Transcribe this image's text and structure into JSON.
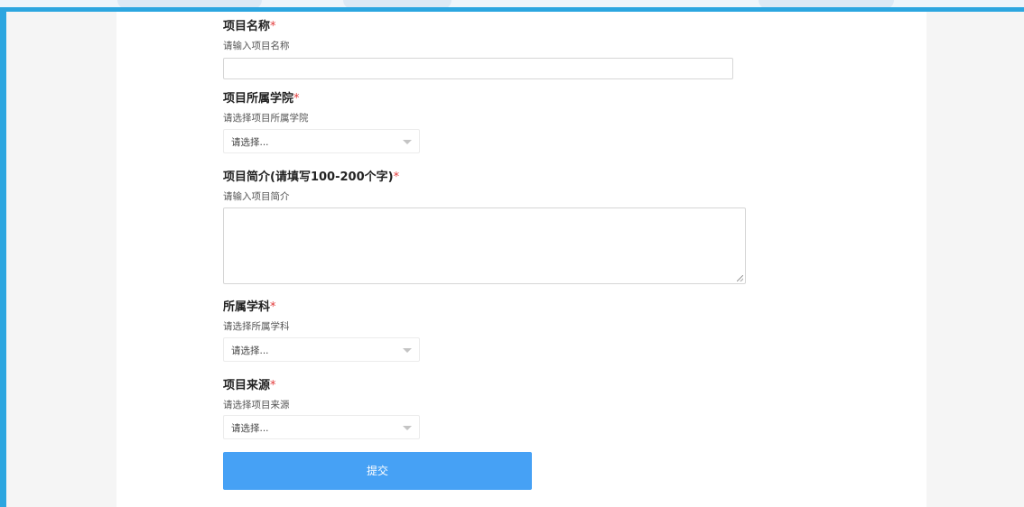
{
  "form": {
    "name": {
      "label": "项目名称",
      "required_mark": "*",
      "hint": "请输入项目名称",
      "value": ""
    },
    "college": {
      "label": "项目所属学院",
      "required_mark": "*",
      "hint": "请选择项目所属学院",
      "selected": "请选择..."
    },
    "intro": {
      "label": "项目简介(请填写100-200个字)",
      "required_mark": "*",
      "hint": "请输入项目简介",
      "value": ""
    },
    "subject": {
      "label": "所属学科",
      "required_mark": "*",
      "hint": "请选择所属学科",
      "selected": "请选择..."
    },
    "source": {
      "label": "项目来源",
      "required_mark": "*",
      "hint": "请选择项目来源",
      "selected": "请选择..."
    },
    "submit_label": "提交"
  },
  "colors": {
    "frame_border": "#2ca6e0",
    "required": "#e23b3b",
    "submit_bg": "#46a1f5"
  }
}
